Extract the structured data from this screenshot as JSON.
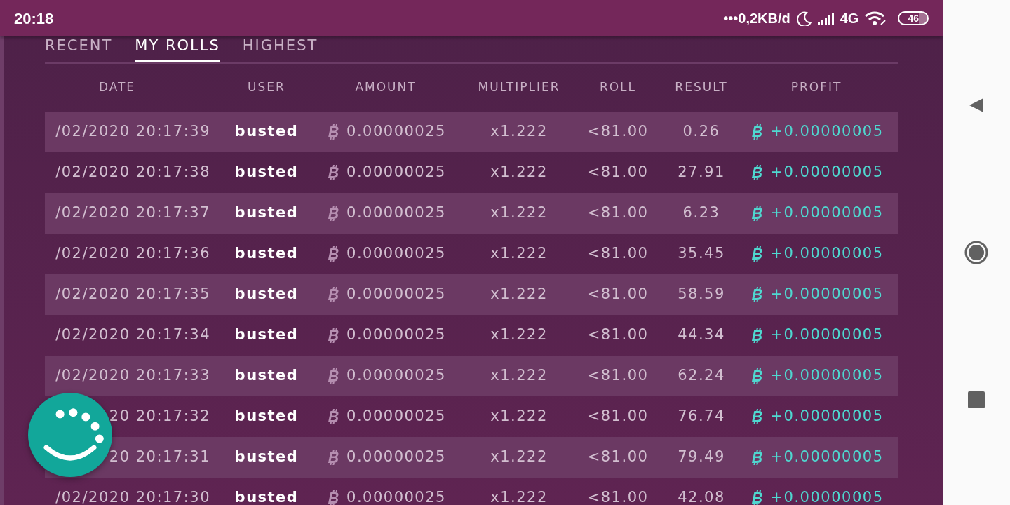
{
  "status_bar": {
    "time": "20:18",
    "network_speed": "•••0,2KB/d",
    "network": "4G",
    "battery": "46"
  },
  "tabs": [
    {
      "label": "RECENT",
      "selected": false
    },
    {
      "label": "MY ROLLS",
      "selected": true
    },
    {
      "label": "HIGHEST",
      "selected": false
    }
  ],
  "table": {
    "columns": [
      "DATE",
      "USER",
      "AMOUNT",
      "MULTIPLIER",
      "ROLL",
      "RESULT",
      "PROFIT"
    ],
    "rows": [
      {
        "date": "/02/2020 20:17:39",
        "user": "busted",
        "amount": "0.00000025",
        "multiplier": "x1.222",
        "roll": "<81.00",
        "result": "0.26",
        "profit": "+0.00000005"
      },
      {
        "date": "/02/2020 20:17:38",
        "user": "busted",
        "amount": "0.00000025",
        "multiplier": "x1.222",
        "roll": "<81.00",
        "result": "27.91",
        "profit": "+0.00000005"
      },
      {
        "date": "/02/2020 20:17:37",
        "user": "busted",
        "amount": "0.00000025",
        "multiplier": "x1.222",
        "roll": "<81.00",
        "result": "6.23",
        "profit": "+0.00000005"
      },
      {
        "date": "/02/2020 20:17:36",
        "user": "busted",
        "amount": "0.00000025",
        "multiplier": "x1.222",
        "roll": "<81.00",
        "result": "35.45",
        "profit": "+0.00000005"
      },
      {
        "date": "/02/2020 20:17:35",
        "user": "busted",
        "amount": "0.00000025",
        "multiplier": "x1.222",
        "roll": "<81.00",
        "result": "58.59",
        "profit": "+0.00000005"
      },
      {
        "date": "/02/2020 20:17:34",
        "user": "busted",
        "amount": "0.00000025",
        "multiplier": "x1.222",
        "roll": "<81.00",
        "result": "44.34",
        "profit": "+0.00000005"
      },
      {
        "date": "/02/2020 20:17:33",
        "user": "busted",
        "amount": "0.00000025",
        "multiplier": "x1.222",
        "roll": "<81.00",
        "result": "62.24",
        "profit": "+0.00000005"
      },
      {
        "date": "20 20:17:32",
        "user": "busted",
        "amount": "0.00000025",
        "multiplier": "x1.222",
        "roll": "<81.00",
        "result": "76.74",
        "profit": "+0.00000005"
      },
      {
        "date": "20 20:17:31",
        "user": "busted",
        "amount": "0.00000025",
        "multiplier": "x1.222",
        "roll": "<81.00",
        "result": "79.49",
        "profit": "+0.00000005"
      },
      {
        "date": "/02/2020 20:17:30",
        "user": "busted",
        "amount": "0.00000025",
        "multiplier": "x1.222",
        "roll": "<81.00",
        "result": "42.08",
        "profit": "+0.00000005"
      }
    ]
  }
}
